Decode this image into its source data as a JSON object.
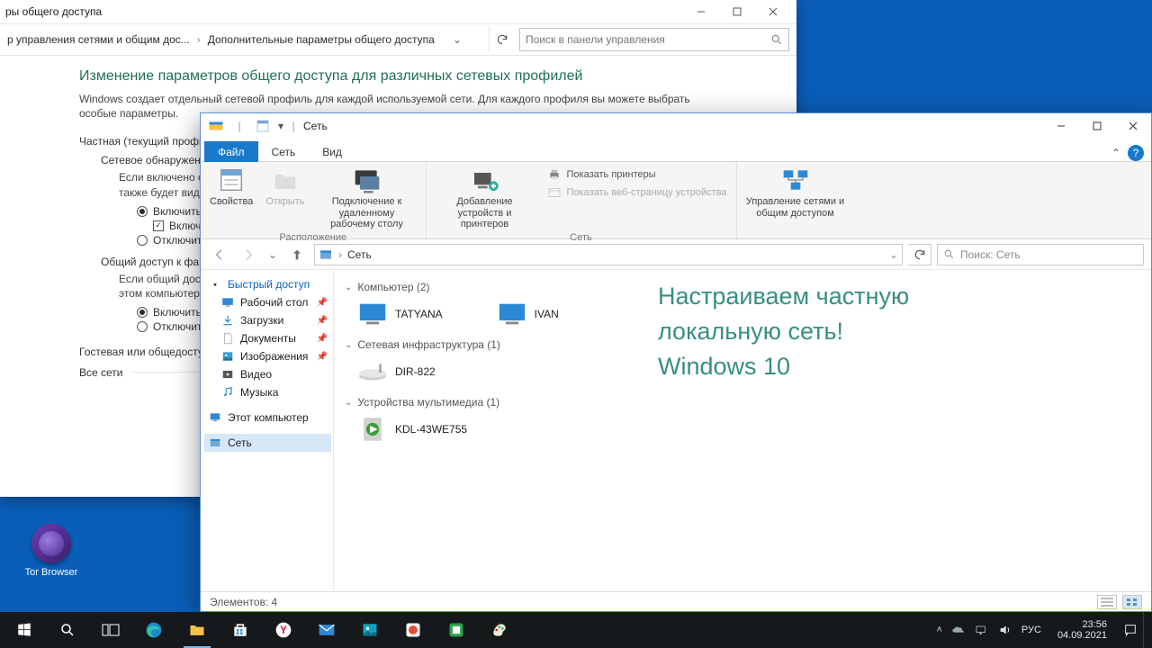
{
  "cp": {
    "title_fragment": "ры общего доступа",
    "breadcrumb": {
      "item1": "р управления сетями и общим дос...",
      "item2": "Дополнительные параметры общего доступа"
    },
    "search_placeholder": "Поиск в панели управления",
    "heading": "Изменение параметров общего доступа для различных сетевых профилей",
    "desc": "Windows создает отдельный сетевой профиль для каждой используемой сети. Для каждого профиля вы можете выбрать особые параметры.",
    "section_private": "Частная (текущий профиль)",
    "net_discovery": "Сетевое обнаружение",
    "net_discovery_desc": "Если включено сетевое обнаружение, этот компьютер может находить другие компьютеры и устройства в сети, а также будет виден для других компьютеров.",
    "radio_on": "Включить сетевое обнаружение",
    "check_auto": "Включить автоматическую настройку на сетевых устройствах",
    "radio_off": "Отключить сетевое обнаружение",
    "file_share": "Общий доступ к файлам и принтерам",
    "file_share_desc": "Если общий доступ к файлам и принтерам включен, файлы и принтеры, к которым разрешен общий доступ на этом компьютере, будут доступны другим пользователям в сети.",
    "radio_fs_on": "Включить общий доступ к файлам и принтерам",
    "radio_fs_off": "Отключить общий доступ к файлам и принтерам",
    "section_guest": "Гостевая или общедоступная",
    "section_all": "Все сети"
  },
  "ex": {
    "title": "Сеть",
    "tabs": {
      "file": "Файл",
      "network": "Сеть",
      "view": "Вид"
    },
    "ribbon": {
      "properties": "Свойства",
      "open": "Открыть",
      "rdp": "Подключение к удаленному рабочему столу",
      "group_location": "Расположение",
      "add_dev": "Добавление устройств и принтеров",
      "show_printers": "Показать принтеры",
      "show_webpage": "Показать веб-страницу устройства",
      "group_network": "Сеть",
      "net_center": "Управление сетями и общим доступом"
    },
    "addr": {
      "root": "Сеть"
    },
    "search_placeholder": "Поиск: Сеть",
    "sidebar": {
      "quick": "Быстрый доступ",
      "desktop": "Рабочий стол",
      "downloads": "Загрузки",
      "documents": "Документы",
      "pictures": "Изображения",
      "video": "Видео",
      "music": "Музыка",
      "thispc": "Этот компьютер",
      "network": "Сеть"
    },
    "groups": {
      "computer": "Компьютер (2)",
      "infra": "Сетевая инфраструктура (1)",
      "media": "Устройства мультимедиа (1)"
    },
    "items": {
      "pc1": "TATYANA",
      "pc2": "IVAN",
      "router": "DIR-822",
      "tv": "KDL-43WE755"
    },
    "status": "Элементов: 4"
  },
  "overlay": {
    "l1": "Настраиваем частную",
    "l2": "локальную сеть!",
    "l3": "Windows 10"
  },
  "desktop": {
    "tor": "Tor Browser"
  },
  "tray": {
    "lang": "РУС",
    "time": "23:56",
    "date": "04.09.2021"
  }
}
